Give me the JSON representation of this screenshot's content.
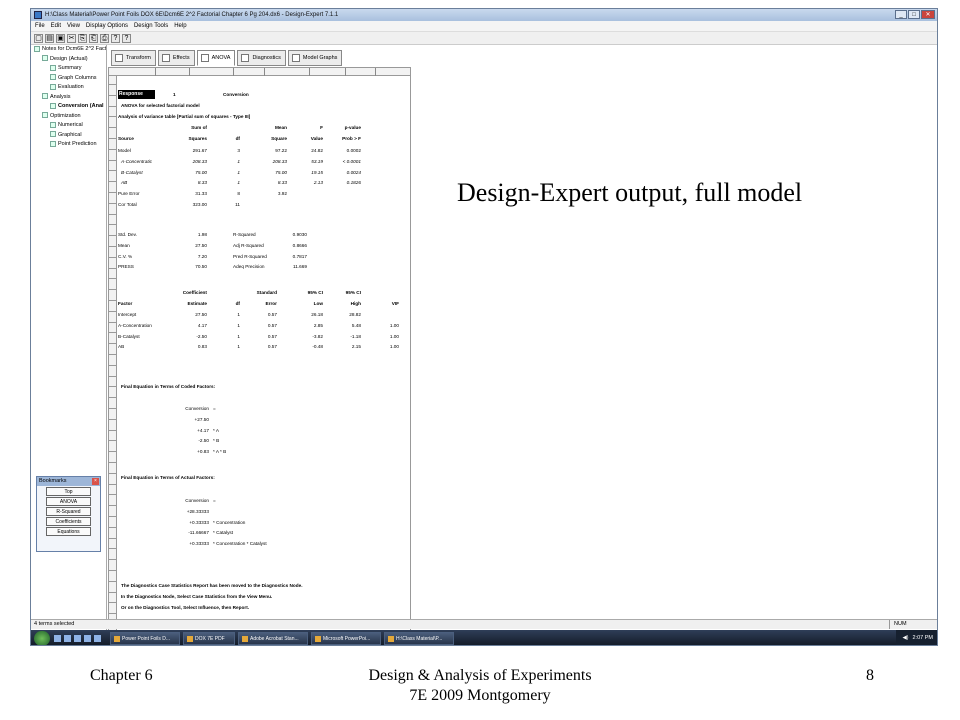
{
  "window": {
    "title": "H:\\Class Material\\Power Point Foils DOX 6E\\Dcm6E 2^2 Factorial Chapter 6 Pg 204.dx6 - Design-Expert 7.1.1",
    "controls": [
      "_",
      "□",
      "✕"
    ]
  },
  "menu": [
    "File",
    "Edit",
    "View",
    "Display Options",
    "Design Tools",
    "Help"
  ],
  "toolbar": [
    "▢",
    "▤",
    "▣",
    "✂",
    "⎘",
    "⎗",
    "⎙",
    "?",
    "?"
  ],
  "tree": [
    {
      "label": "Notes for Dcm6E 2^2 Facto",
      "indent": 0
    },
    {
      "label": "Design (Actual)",
      "indent": 1
    },
    {
      "label": "Summary",
      "indent": 2
    },
    {
      "label": "Graph Columns",
      "indent": 2
    },
    {
      "label": "Evaluation",
      "indent": 2
    },
    {
      "label": "Analysis",
      "indent": 1
    },
    {
      "label": "Conversion (Anal",
      "indent": 2,
      "bold": true
    },
    {
      "label": "Optimization",
      "indent": 1
    },
    {
      "label": "Numerical",
      "indent": 2
    },
    {
      "label": "Graphical",
      "indent": 2
    },
    {
      "label": "Point Prediction",
      "indent": 2
    }
  ],
  "bookmarks": {
    "title": "Bookmarks",
    "items": [
      "Top",
      "ANOVA",
      "R-Squared",
      "Coefficients",
      "Equations"
    ]
  },
  "tabs": [
    "Transform",
    "Effects",
    "ANOVA",
    "Diagnostics",
    "Model Graphs"
  ],
  "report": {
    "response_label": "Response",
    "response_num": "1",
    "response_name": "Conversion",
    "anova_title": "ANOVA for selected factorial model",
    "anova_sub": "Analysis of variance table [Partial sum of squares - Type III]",
    "hdr1": [
      "Sum of",
      "Mean",
      "F",
      "p-value"
    ],
    "hdr2": [
      "Source",
      "Squares",
      "df",
      "Square",
      "Value",
      "Prob > F"
    ],
    "anova_rows": [
      [
        "Model",
        "291.67",
        "3",
        "97.22",
        "24.82",
        "0.0002",
        ""
      ],
      [
        "A-Concentratic",
        "208.33",
        "1",
        "208.33",
        "53.19",
        "< 0.0001",
        "it"
      ],
      [
        "B-Catalyst",
        "75.00",
        "1",
        "75.00",
        "19.15",
        "0.0024",
        "it"
      ],
      [
        "AB",
        "8.33",
        "1",
        "8.33",
        "2.13",
        "0.1826",
        "it"
      ],
      [
        "Pure Error",
        "31.33",
        "8",
        "3.92",
        "",
        "",
        ""
      ],
      [
        "Cor Total",
        "323.00",
        "11",
        "",
        "",
        "",
        ""
      ]
    ],
    "fit_rows": [
      [
        "Std. Dev.",
        "1.98",
        "R-Squared",
        "0.9030"
      ],
      [
        "Mean",
        "27.50",
        "Adj R-Squared",
        "0.8666"
      ],
      [
        "C.V. %",
        "7.20",
        "Pred R-Squared",
        "0.7817"
      ],
      [
        "PRESS",
        "70.50",
        "Adeq Precision",
        "11.669"
      ]
    ],
    "coef_hdr1": [
      "Coefficient",
      "Standard",
      "95% CI",
      "95% CI"
    ],
    "coef_hdr2": [
      "Factor",
      "Estimate",
      "df",
      "Error",
      "Low",
      "High",
      "VIF"
    ],
    "coef_rows": [
      [
        "Intercept",
        "27.50",
        "1",
        "0.57",
        "26.18",
        "28.82",
        ""
      ],
      [
        "A-Concentration",
        "4.17",
        "1",
        "0.57",
        "2.85",
        "5.48",
        "1.00"
      ],
      [
        "B-Catalyst",
        "-2.50",
        "1",
        "0.57",
        "-3.82",
        "-1.18",
        "1.00"
      ],
      [
        "AB",
        "0.83",
        "1",
        "0.57",
        "-0.48",
        "2.15",
        "1.00"
      ]
    ],
    "coded_title": "Final Equation in Terms of Coded Factors:",
    "coded_lines": [
      [
        "Conversion",
        "="
      ],
      [
        "+27.50",
        ""
      ],
      [
        "+4.17",
        "* A"
      ],
      [
        "-2.50",
        "* B"
      ],
      [
        "+0.83",
        "* A * B"
      ]
    ],
    "actual_title": "Final Equation in Terms of Actual Factors:",
    "actual_lines": [
      [
        "Conversion",
        "="
      ],
      [
        "+28.33333",
        ""
      ],
      [
        "+0.33333",
        "* Concentration"
      ],
      [
        "-11.66667",
        "* Catalyst"
      ],
      [
        "+0.33333",
        "* Concentration * Catalyst"
      ]
    ],
    "notes": [
      "The Diagnostics Case Statistics Report has been moved to the Diagnostics Node.",
      "In the Diagnostics Node, Select Case Statistics from the View Menu.",
      "Or on the Diagnostics Tool, Select Influence, then Report."
    ]
  },
  "status": {
    "text": "4 terms selected",
    "num": "NUM"
  },
  "taskbar": {
    "buttons": [
      "Power Point Foils D...",
      "DOX 7E PDF",
      "Adobe Acrobat Stan...",
      "Microsoft PowerPoi...",
      "H:\\Class Material\\P..."
    ],
    "clock": "2:07 PM"
  },
  "slide": {
    "overlay": "Design-Expert output, full model",
    "footer_left": "Chapter 6",
    "footer_center": "Design & Analysis of Experiments\n7E 2009 Montgomery",
    "footer_right": "8"
  }
}
